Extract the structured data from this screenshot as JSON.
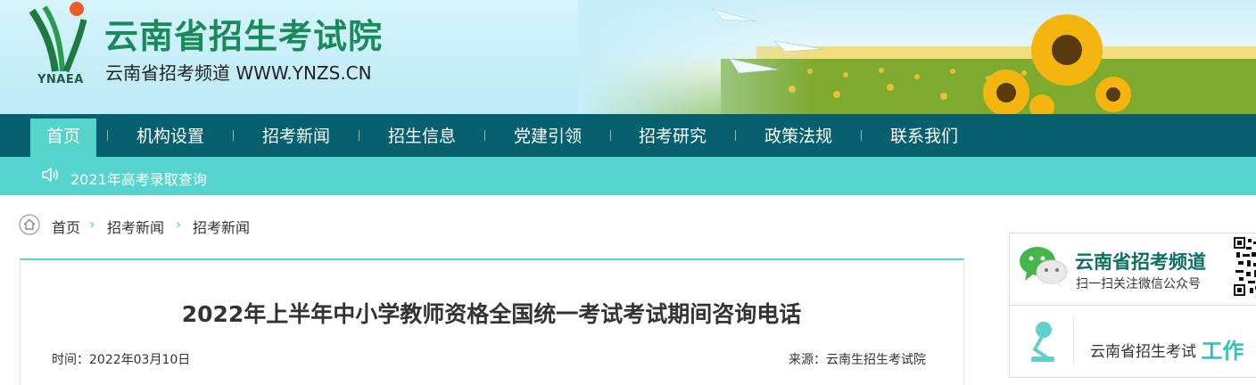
{
  "header": {
    "logo_text": "YNAEA",
    "site_title": "云南省招生考试院",
    "site_subtitle": "云南省招考频道  WWW.YNZS.CN"
  },
  "nav": {
    "items": [
      {
        "label": "首页"
      },
      {
        "label": "机构设置"
      },
      {
        "label": "招考新闻"
      },
      {
        "label": "招生信息"
      },
      {
        "label": "党建引领"
      },
      {
        "label": "招考研究"
      },
      {
        "label": "政策法规"
      },
      {
        "label": "联系我们"
      }
    ]
  },
  "notice": {
    "text": "2021年高考录取查询"
  },
  "breadcrumb": {
    "items": [
      "首页",
      "招考新闻",
      "招考新闻"
    ],
    "separator": "›"
  },
  "article": {
    "title": "2022年上半年中小学教师资格全国统一考试考试期间咨询电话",
    "time": "时间：2022年03月10日",
    "source": "来源：云南生招生考试院"
  },
  "sidebar": {
    "wechat_title": "云南省招考频道",
    "wechat_sub": "扫一扫关注微信公众号",
    "card2_text": "云南省招生考试",
    "card2_accent": "工作"
  },
  "colors": {
    "nav_bg": "#07606d",
    "accent": "#56d4c9",
    "title_green": "#1a8a5a"
  }
}
